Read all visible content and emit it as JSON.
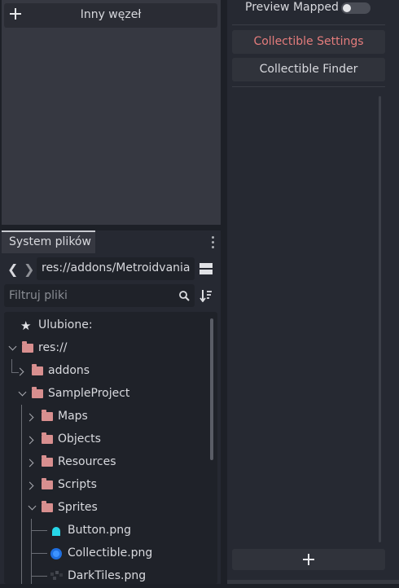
{
  "scene_panel": {
    "add_node_label": "Inny węzeł"
  },
  "right_panel": {
    "preview_mapped_label": "Preview Mapped",
    "preview_mapped_on": false,
    "collectible_settings_label": "Collectible Settings",
    "collectible_finder_label": "Collectible Finder",
    "accent_color": "#e47c7c"
  },
  "filesystem": {
    "tab_label": "System plików",
    "path": "res://addons/Metroidvania",
    "filter_placeholder": "Filtruj pliki",
    "tree": {
      "favorites": "Ulubione:",
      "root": "res://",
      "addons": "addons",
      "sample_project": "SampleProject",
      "maps": "Maps",
      "objects": "Objects",
      "resources": "Resources",
      "scripts": "Scripts",
      "sprites": "Sprites",
      "button_png": "Button.png",
      "collectible_png": "Collectible.png",
      "darktiles_png": "DarkTiles.png"
    },
    "folder_color": "#d88f8f"
  }
}
